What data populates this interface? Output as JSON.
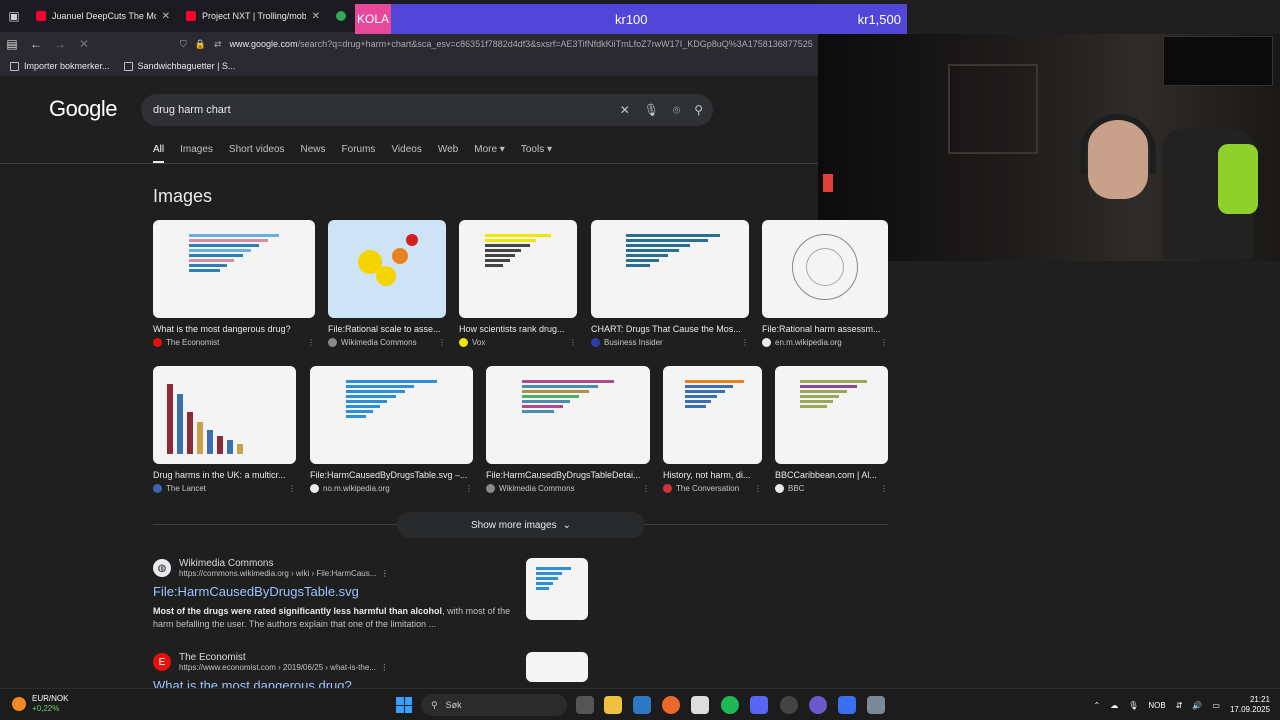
{
  "browser": {
    "tabs": [
      {
        "title": "Juanuel DeepCuts The Movie P"
      },
      {
        "title": "Project NXT | Trolling/mobbing"
      }
    ],
    "url_host": "www.google.com",
    "url_path": "/search?q=drug+harm+chart&sca_esv=c86351f7882d4df3&sxsrf=AE3TifNfdkKiiTmLfoZ7rwW17I_KDGp8uQ%3A1758136877525",
    "bookmarks": [
      {
        "label": "Importer bokmerker..."
      },
      {
        "label": "Sandwichbaguetter | S..."
      }
    ]
  },
  "donation_bar": {
    "label": "KOLA",
    "current": "kr100",
    "goal": "kr1,500"
  },
  "google": {
    "logo": "Google",
    "query": "drug harm chart",
    "tabs": [
      "All",
      "Images",
      "Short videos",
      "News",
      "Forums",
      "Videos",
      "Web",
      "More",
      "Tools"
    ],
    "images_heading": "Images",
    "images_row1": [
      {
        "caption": "What is the most dangerous drug?",
        "source": "The Economist"
      },
      {
        "caption": "File:Rational scale to asse...",
        "source": "Wikimedia Commons"
      },
      {
        "caption": "How scientists rank drug...",
        "source": "Vox"
      },
      {
        "caption": "CHART: Drugs That Cause the Mos...",
        "source": "Business Insider"
      },
      {
        "caption": "File:Rational harm assessm...",
        "source": "en.m.wikipedia.org"
      }
    ],
    "images_row2": [
      {
        "caption": "Drug harms in the UK: a multicr...",
        "source": "The Lancet"
      },
      {
        "caption": "File:HarmCausedByDrugsTable.svg –...",
        "source": "no.m.wikipedia.org"
      },
      {
        "caption": "File:HarmCausedByDrugsTableDetai...",
        "source": "Wikimedia Commons"
      },
      {
        "caption": "History, not harm, di...",
        "source": "The Conversation"
      },
      {
        "caption": "BBCCaribbean.com | Al...",
        "source": "BBC"
      }
    ],
    "show_more": "Show more images",
    "results": [
      {
        "site": "Wikimedia Commons",
        "url": "https://commons.wikimedia.org › wiki › File:HarmCaus...",
        "title": "File:HarmCausedByDrugsTable.svg",
        "snippet_bold": "Most of the drugs were rated significantly less harmful than alcohol",
        "snippet_rest": ", with most of the harm befalling the user. The authors explain that one of the limitation ..."
      },
      {
        "site": "The Economist",
        "url": "https://www.economist.com › 2019/06/25 › what-is-the...",
        "title": "What is the most dangerous drug?"
      }
    ]
  },
  "taskbar": {
    "ticker_name": "EUR/NOK",
    "ticker_change": "+0,22%",
    "search_label": "Søk",
    "lang": "NOB",
    "time": "21:21",
    "date": "17.09.2025"
  }
}
